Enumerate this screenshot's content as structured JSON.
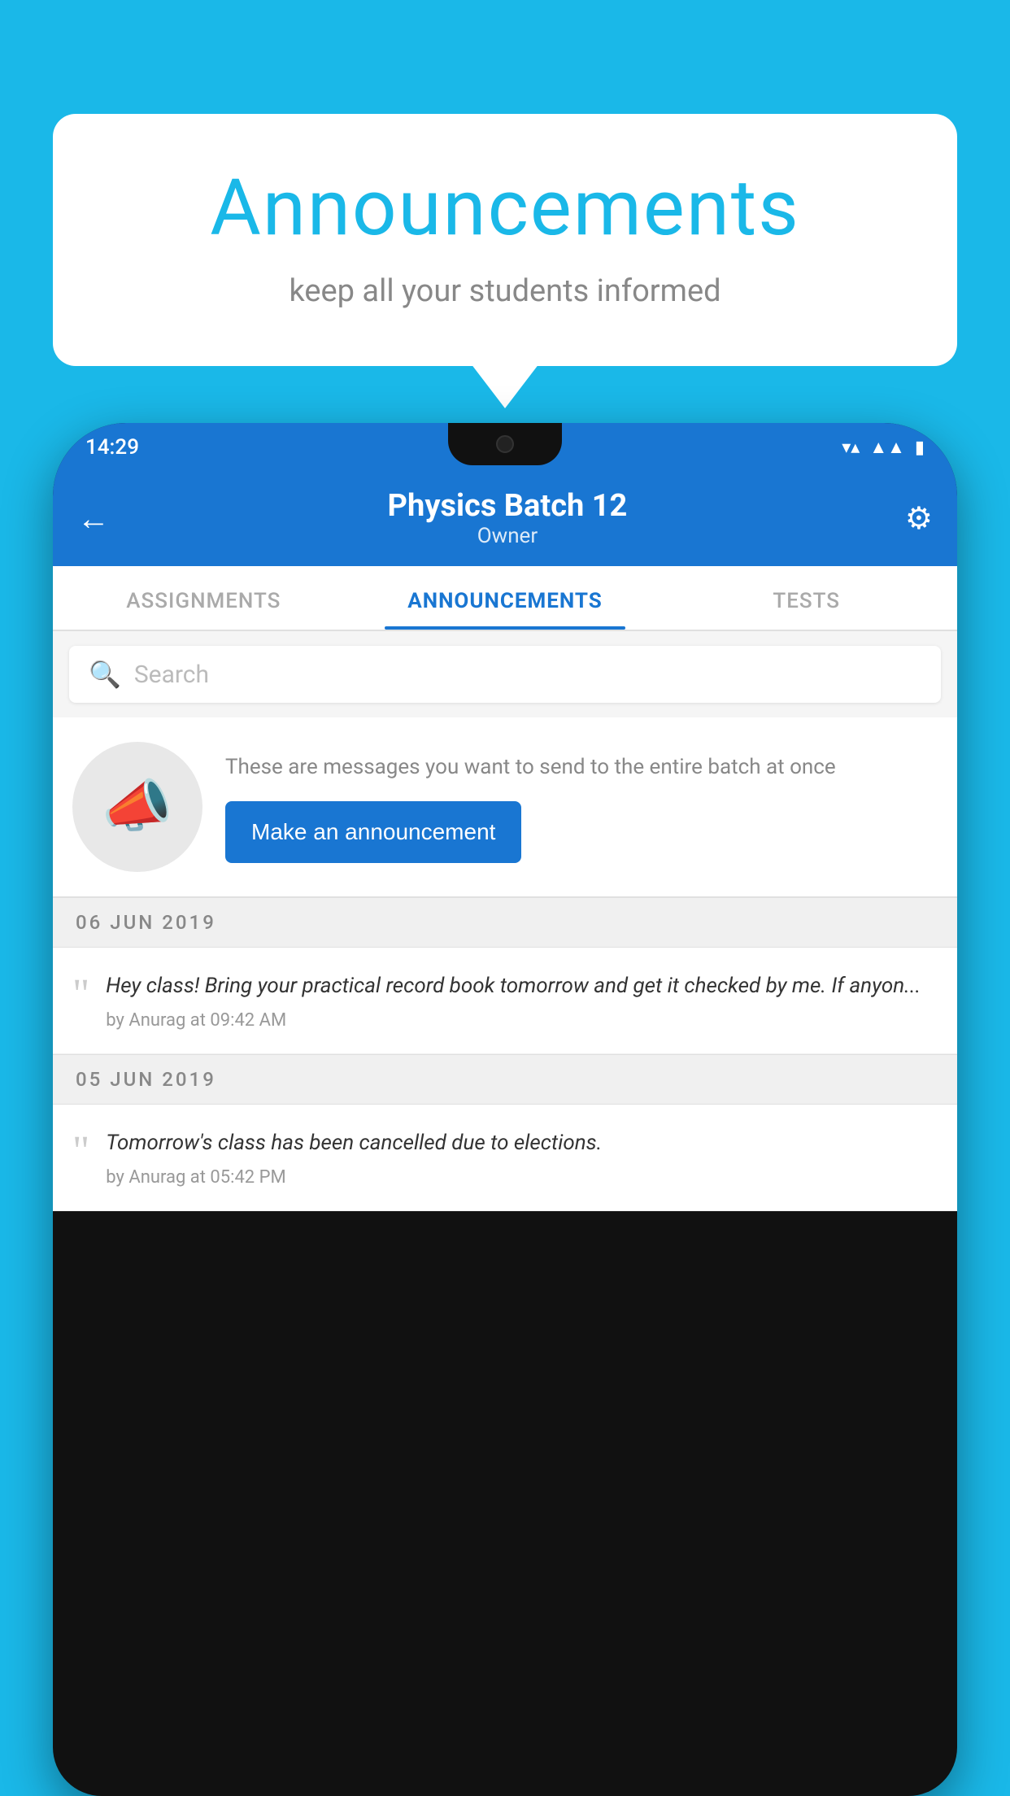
{
  "background_color": "#1ab8e8",
  "card": {
    "title": "Announcements",
    "subtitle": "keep all your students informed"
  },
  "phone": {
    "status_bar": {
      "time": "14:29",
      "icons": [
        "wifi",
        "signal",
        "battery"
      ]
    },
    "header": {
      "title": "Physics Batch 12",
      "subtitle": "Owner",
      "back_label": "←",
      "settings_label": "⚙"
    },
    "tabs": [
      {
        "label": "ASSIGNMENTS",
        "active": false
      },
      {
        "label": "ANNOUNCEMENTS",
        "active": true
      },
      {
        "label": "TESTS",
        "active": false
      }
    ],
    "search": {
      "placeholder": "Search"
    },
    "promo": {
      "description": "These are messages you want to send to the entire batch at once",
      "button_label": "Make an announcement"
    },
    "announcements": [
      {
        "date": "06  JUN  2019",
        "message": "Hey class! Bring your practical record book tomorrow and get it checked by me. If anyon...",
        "meta": "by Anurag at 09:42 AM"
      },
      {
        "date": "05  JUN  2019",
        "message": "Tomorrow's class has been cancelled due to elections.",
        "meta": "by Anurag at 05:42 PM"
      }
    ]
  }
}
